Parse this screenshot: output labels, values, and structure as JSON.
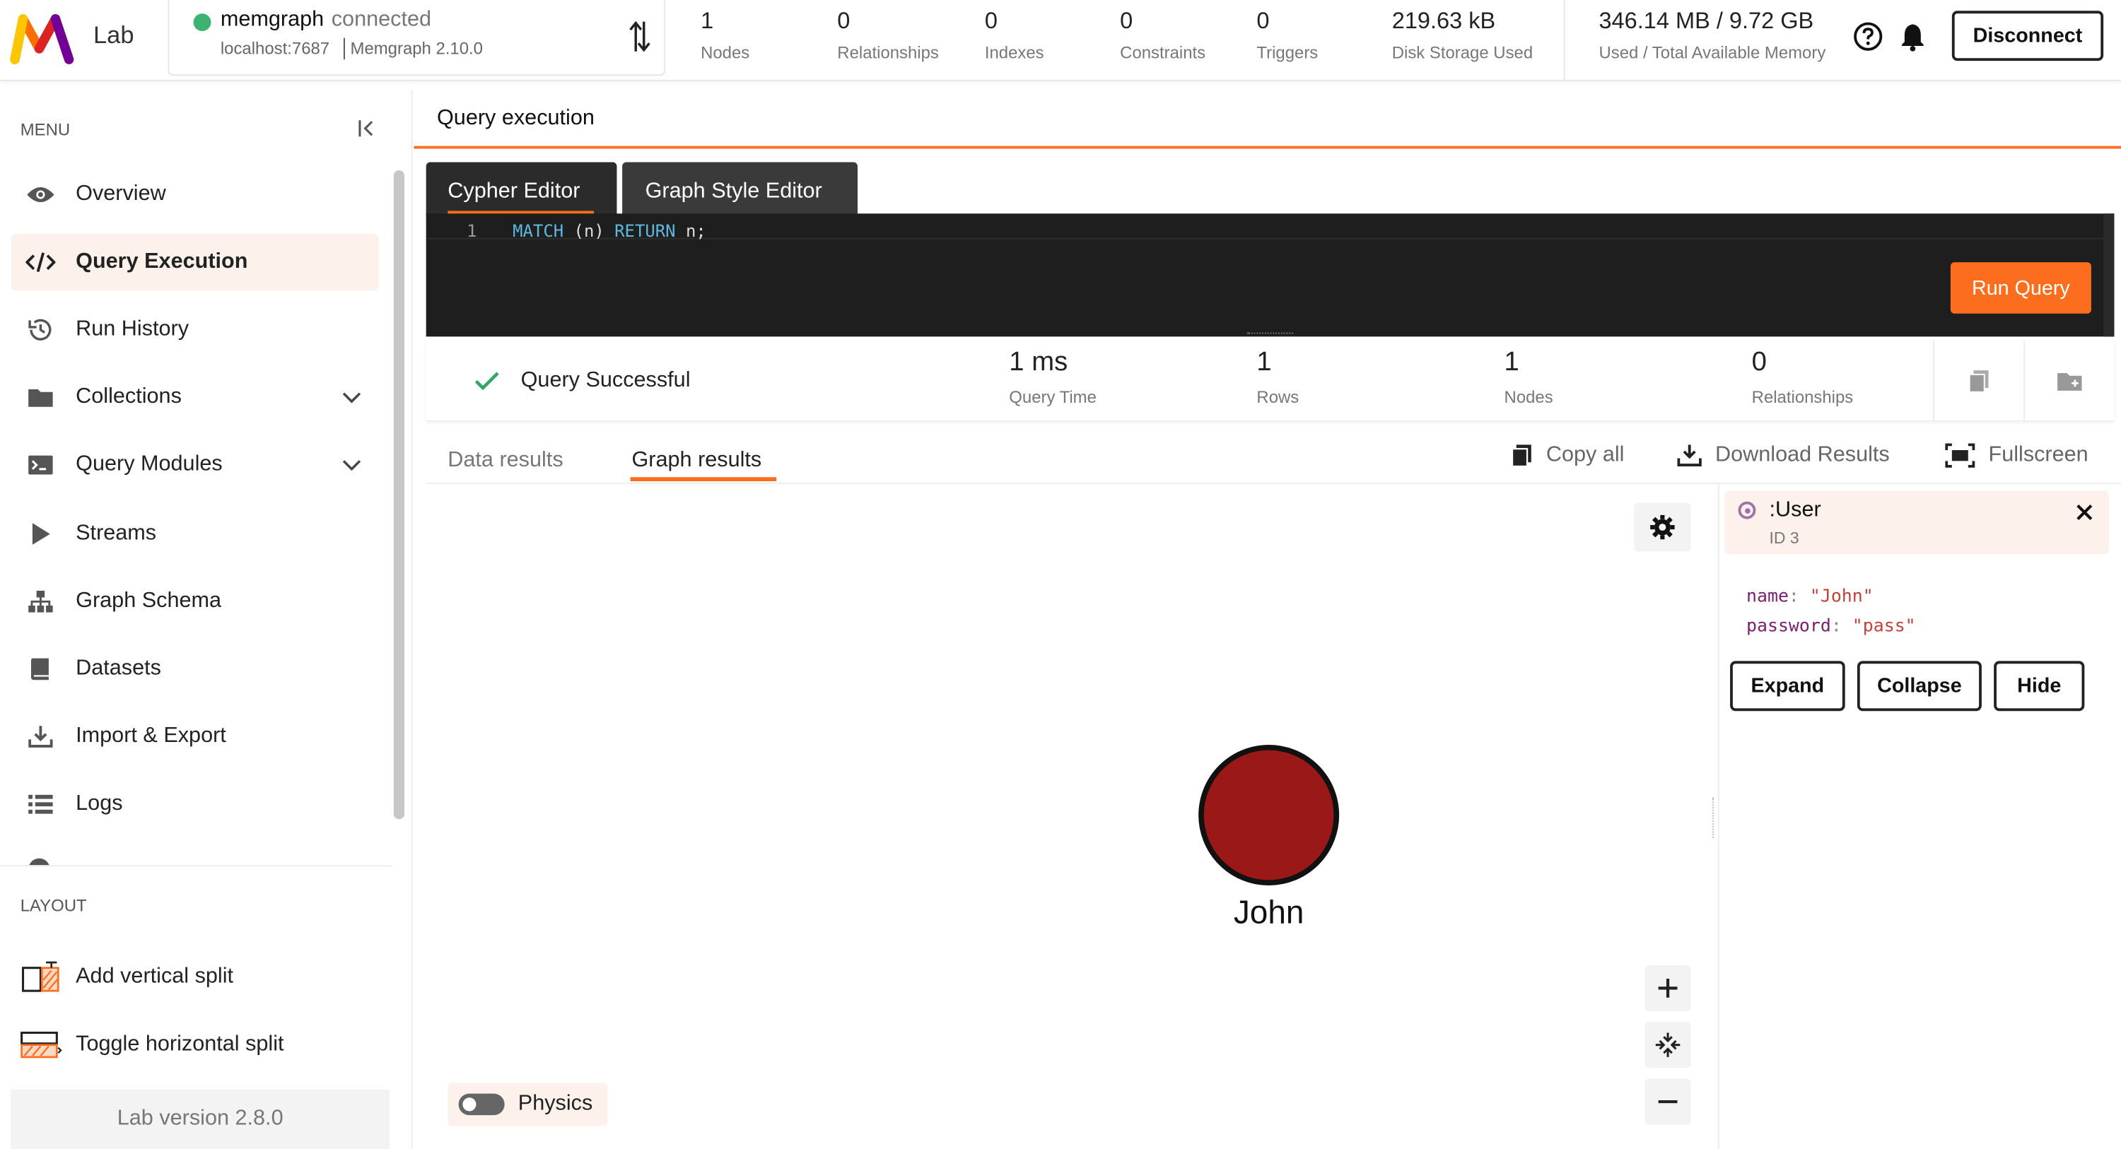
{
  "app": {
    "name": "Lab",
    "logo": "memgraph-m-logo"
  },
  "connection": {
    "db_name": "memgraph",
    "status": "connected",
    "host": "localhost:7687",
    "version": "Memgraph 2.10.0",
    "status_color": "#3cb371"
  },
  "stats": [
    {
      "value": "1",
      "label": "Nodes"
    },
    {
      "value": "0",
      "label": "Relationships"
    },
    {
      "value": "0",
      "label": "Indexes"
    },
    {
      "value": "0",
      "label": "Constraints"
    },
    {
      "value": "0",
      "label": "Triggers"
    },
    {
      "value": "219.63 kB",
      "label": "Disk Storage Used"
    },
    {
      "value": "346.14 MB / 9.72 GB",
      "label": "Used / Total Available Memory"
    }
  ],
  "header_actions": {
    "disconnect_label": "Disconnect"
  },
  "sidebar": {
    "menu_title": "MENU",
    "items": [
      {
        "label": "Overview",
        "icon": "eye-icon"
      },
      {
        "label": "Query Execution",
        "icon": "code-icon",
        "active": true
      },
      {
        "label": "Run History",
        "icon": "history-icon"
      },
      {
        "label": "Collections",
        "icon": "folder-icon"
      },
      {
        "label": "Query Modules",
        "icon": "terminal-icon"
      },
      {
        "label": "Streams",
        "icon": "play-icon"
      },
      {
        "label": "Graph Schema",
        "icon": "hierarchy-icon"
      },
      {
        "label": "Datasets",
        "icon": "book-icon"
      },
      {
        "label": "Import & Export",
        "icon": "download-icon"
      },
      {
        "label": "Logs",
        "icon": "list-icon"
      }
    ],
    "layout_title": "LAYOUT",
    "layout_items": [
      {
        "label": "Add vertical split",
        "icon": "vertical-split-icon"
      },
      {
        "label": "Toggle horizontal split",
        "icon": "horizontal-split-icon"
      }
    ],
    "version": "Lab version 2.8.0"
  },
  "main": {
    "title": "Query execution",
    "editor_tabs": [
      "Cypher Editor",
      "Graph Style Editor"
    ],
    "editor": {
      "line_number": "1",
      "kw1": "MATCH",
      "mid": " (n) ",
      "kw2": "RETURN",
      "rest": " n;"
    },
    "run_label": "Run Query",
    "summary": {
      "status": "Query Successful",
      "items": [
        {
          "value": "1 ms",
          "label": "Query Time"
        },
        {
          "value": "1",
          "label": "Rows"
        },
        {
          "value": "1",
          "label": "Nodes"
        },
        {
          "value": "0",
          "label": "Relationships"
        }
      ]
    },
    "result_tabs": [
      "Data results",
      "Graph results"
    ],
    "tools": {
      "copy": "Copy all",
      "download": "Download Results",
      "fullscreen": "Fullscreen"
    },
    "graph": {
      "node_label": "John",
      "node_color": "#9b1818",
      "physics_label": "Physics"
    },
    "inspector": {
      "label": ":User",
      "id": "ID 3",
      "props": [
        {
          "key": "name",
          "value": "\"John\""
        },
        {
          "key": "password",
          "value": "\"pass\""
        }
      ],
      "buttons": [
        "Expand",
        "Collapse",
        "Hide"
      ]
    }
  },
  "colors": {
    "accent": "#fc6d1e",
    "active_bg": "#fdf1ec"
  }
}
